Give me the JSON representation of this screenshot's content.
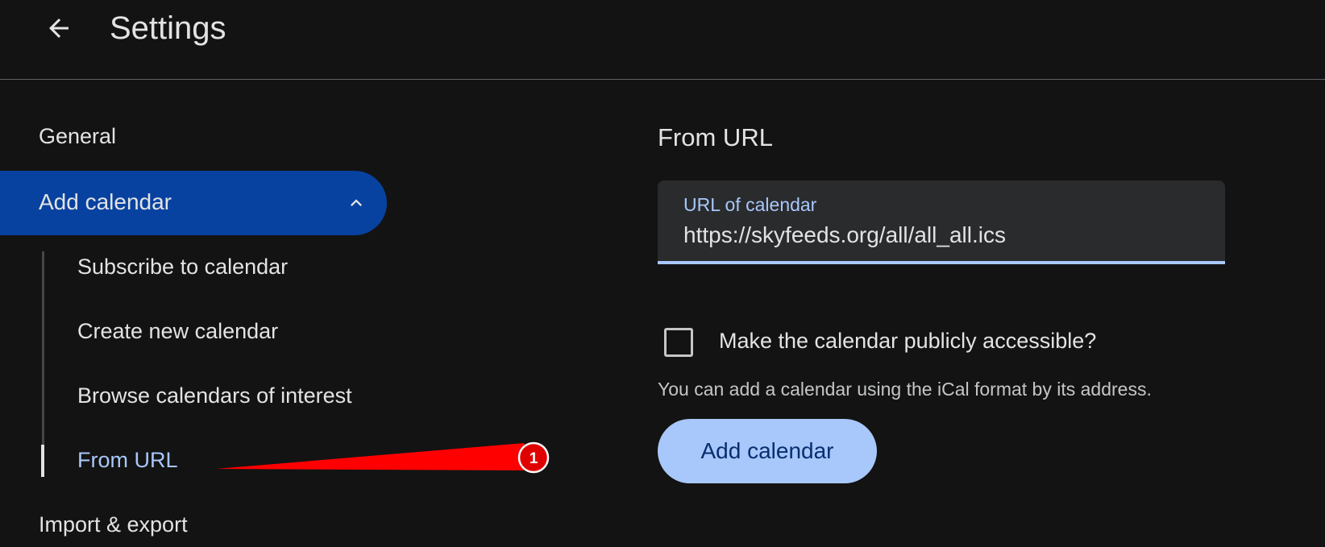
{
  "header": {
    "title": "Settings",
    "back_icon": "arrow-left-icon"
  },
  "sidebar": {
    "general": "General",
    "add_calendar": {
      "label": "Add calendar",
      "icon": "chevron-up-icon",
      "expanded": true
    },
    "sub_items": [
      {
        "label": "Subscribe to calendar"
      },
      {
        "label": "Create new calendar"
      },
      {
        "label": "Browse calendars of interest"
      },
      {
        "label": "From URL",
        "selected": true
      }
    ],
    "import_export": "Import & export"
  },
  "main": {
    "section_title": "From URL",
    "url_field": {
      "label": "URL of calendar",
      "value": "https://skyfeeds.org/all/all_all.ics"
    },
    "public_checkbox": {
      "label": "Make the calendar publicly accessible?",
      "checked": false
    },
    "helper_text": "You can add a calendar using the iCal format by its address.",
    "add_button": "Add calendar"
  },
  "annotation": {
    "badge": "1"
  },
  "colors": {
    "background": "#131313",
    "active_nav": "#0842a0",
    "accent": "#a8c7fa",
    "field_bg": "#2a2b2d",
    "button_text": "#062e6f",
    "annotation": "#ff0000"
  }
}
